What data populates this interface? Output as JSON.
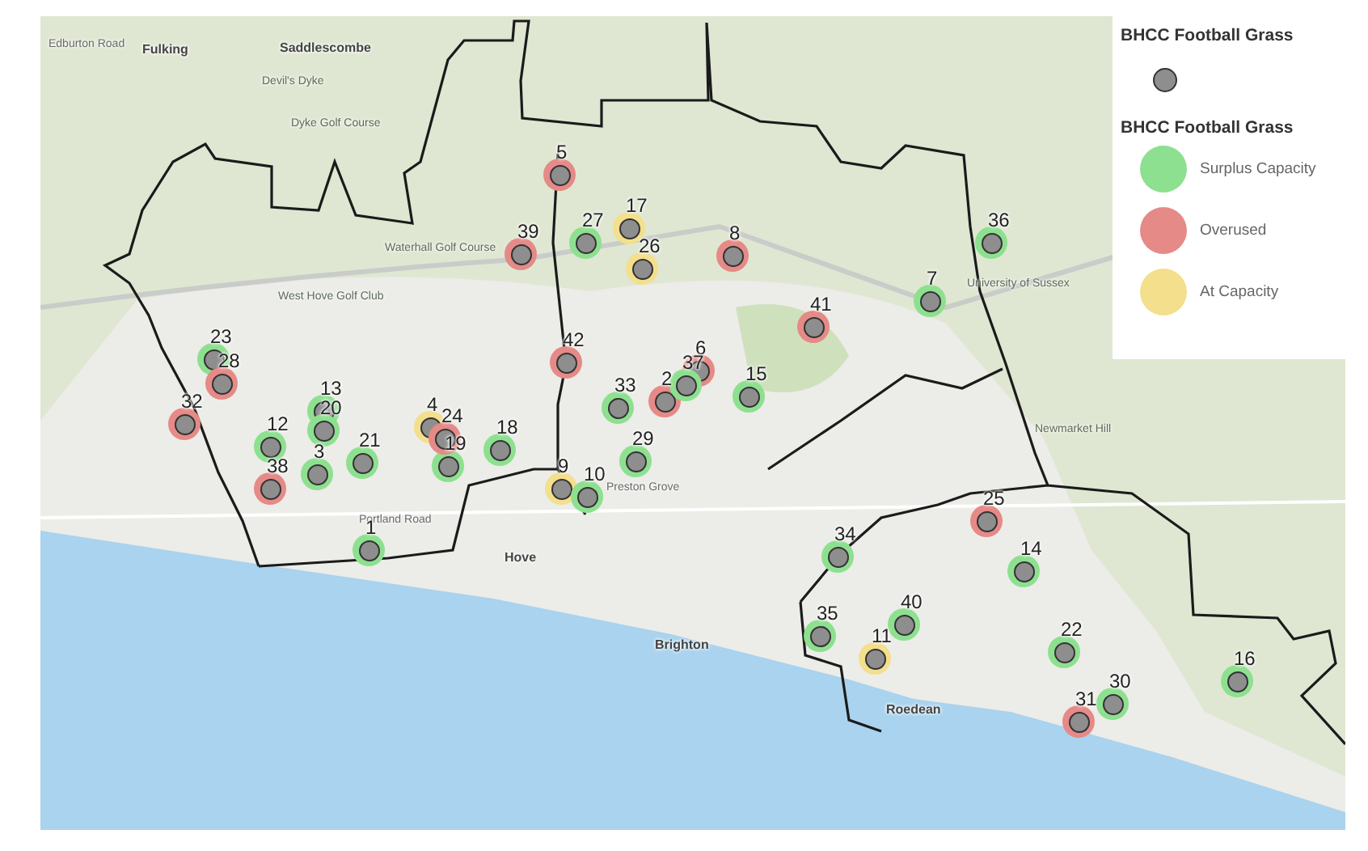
{
  "map": {
    "place_labels": [
      {
        "text": "Edburton Road",
        "kind": "road"
      },
      {
        "text": "Fulking",
        "kind": "place"
      },
      {
        "text": "Saddlescombe",
        "kind": "place"
      },
      {
        "text": "Devil's Dyke",
        "kind": "feature"
      },
      {
        "text": "Dyke Golf Course",
        "kind": "feature"
      },
      {
        "text": "Waterhall Golf Course",
        "kind": "feature"
      },
      {
        "text": "West Hove Golf Club",
        "kind": "feature"
      },
      {
        "text": "Hove",
        "kind": "place"
      },
      {
        "text": "Brighton",
        "kind": "place"
      },
      {
        "text": "Portland Road",
        "kind": "road"
      },
      {
        "text": "University of Sussex",
        "kind": "feature"
      },
      {
        "text": "Newmarket Hill",
        "kind": "feature"
      },
      {
        "text": "Roedean",
        "kind": "place"
      },
      {
        "text": "Preston Grove",
        "kind": "road"
      }
    ],
    "pins": [
      {
        "number": "1",
        "kind": "surplus"
      },
      {
        "number": "2",
        "kind": "overused"
      },
      {
        "number": "3",
        "kind": "surplus"
      },
      {
        "number": "4",
        "kind": "at-capacity"
      },
      {
        "number": "5",
        "kind": "overused"
      },
      {
        "number": "6",
        "kind": "overused"
      },
      {
        "number": "7",
        "kind": "surplus"
      },
      {
        "number": "8",
        "kind": "overused"
      },
      {
        "number": "9",
        "kind": "at-capacity"
      },
      {
        "number": "10",
        "kind": "surplus"
      },
      {
        "number": "11",
        "kind": "at-capacity"
      },
      {
        "number": "12",
        "kind": "surplus"
      },
      {
        "number": "13",
        "kind": "surplus"
      },
      {
        "number": "14",
        "kind": "surplus"
      },
      {
        "number": "15",
        "kind": "surplus"
      },
      {
        "number": "16",
        "kind": "surplus"
      },
      {
        "number": "17",
        "kind": "at-capacity"
      },
      {
        "number": "18",
        "kind": "surplus"
      },
      {
        "number": "19",
        "kind": "surplus"
      },
      {
        "number": "20",
        "kind": "surplus"
      },
      {
        "number": "21",
        "kind": "surplus"
      },
      {
        "number": "22",
        "kind": "surplus"
      },
      {
        "number": "23",
        "kind": "surplus"
      },
      {
        "number": "24",
        "kind": "overused"
      },
      {
        "number": "25",
        "kind": "overused"
      },
      {
        "number": "26",
        "kind": "at-capacity"
      },
      {
        "number": "27",
        "kind": "surplus"
      },
      {
        "number": "28",
        "kind": "overused"
      },
      {
        "number": "29",
        "kind": "surplus"
      },
      {
        "number": "30",
        "kind": "surplus"
      },
      {
        "number": "31",
        "kind": "overused"
      },
      {
        "number": "32",
        "kind": "overused"
      },
      {
        "number": "33",
        "kind": "surplus"
      },
      {
        "number": "34",
        "kind": "surplus"
      },
      {
        "number": "35",
        "kind": "surplus"
      },
      {
        "number": "36",
        "kind": "surplus"
      },
      {
        "number": "37",
        "kind": "surplus"
      },
      {
        "number": "38",
        "kind": "overused"
      },
      {
        "number": "39",
        "kind": "overused"
      },
      {
        "number": "40",
        "kind": "surplus"
      },
      {
        "number": "41",
        "kind": "overused"
      },
      {
        "number": "42",
        "kind": "overused"
      }
    ]
  },
  "legend": {
    "layer_title": "BHCC Football Grass",
    "category_title": "BHCC Football Grass",
    "items": [
      {
        "label": "Surplus Capacity",
        "kind": "surplus",
        "color": "#8de08f"
      },
      {
        "label": "Overused",
        "kind": "overused",
        "color": "#e58a87"
      },
      {
        "label": "At Capacity",
        "kind": "at-capacity",
        "color": "#f3df8c"
      }
    ]
  }
}
